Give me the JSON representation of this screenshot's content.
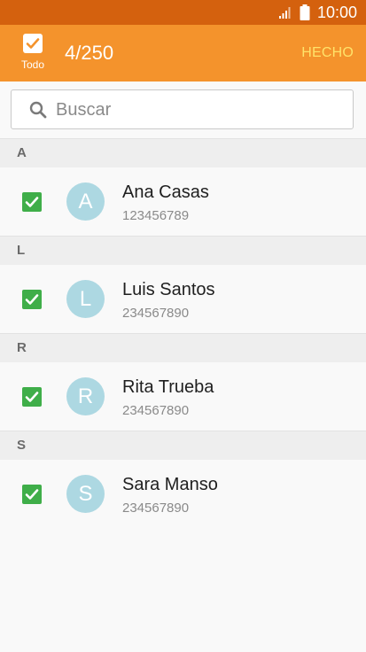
{
  "status_bar": {
    "time": "10:00",
    "signal_icon": "signal-icon",
    "battery_icon": "battery-icon"
  },
  "action_bar": {
    "select_all_label": "Todo",
    "count": "4/250",
    "done_label": "HECHO"
  },
  "search": {
    "placeholder": "Buscar",
    "value": ""
  },
  "sections": [
    {
      "letter": "A",
      "contacts": [
        {
          "initial": "A",
          "name": "Ana Casas",
          "phone": "123456789",
          "checked": true
        }
      ]
    },
    {
      "letter": "L",
      "contacts": [
        {
          "initial": "L",
          "name": "Luis Santos",
          "phone": "234567890",
          "checked": true
        }
      ]
    },
    {
      "letter": "R",
      "contacts": [
        {
          "initial": "R",
          "name": "Rita Trueba",
          "phone": "234567890",
          "checked": true
        }
      ]
    },
    {
      "letter": "S",
      "contacts": [
        {
          "initial": "S",
          "name": "Sara Manso",
          "phone": "234567890",
          "checked": true
        }
      ]
    }
  ],
  "colors": {
    "status_bar": "#d4610e",
    "action_bar": "#f4932c",
    "done_text": "#ffe36a",
    "checkbox": "#3fae49",
    "avatar": "#add8e2"
  }
}
